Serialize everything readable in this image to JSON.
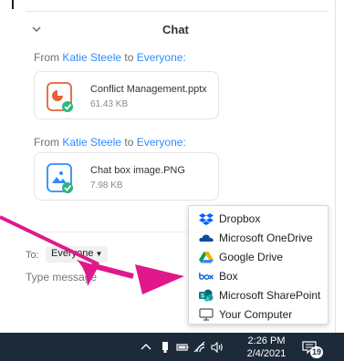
{
  "chat": {
    "title": "Chat",
    "messages": [
      {
        "from_prefix": "From ",
        "sender": "Katie Steele",
        "to_word": " to ",
        "recipient": "Everyone:",
        "file_name": "Conflict Management.pptx",
        "file_size": "61.43 KB",
        "file_type": "pptx"
      },
      {
        "from_prefix": "From ",
        "sender": "Katie Steele",
        "to_word": " to ",
        "recipient": "Everyone:",
        "file_name": "Chat box image.PNG",
        "file_size": "7.98 KB",
        "file_type": "png"
      }
    ],
    "to_label": "To:",
    "to_value": "Everyone",
    "message_placeholder": "Type message"
  },
  "share_menu": {
    "items": [
      {
        "label": "Dropbox",
        "icon": "dropbox-icon",
        "color": "#0061ff"
      },
      {
        "label": "Microsoft OneDrive",
        "icon": "onedrive-icon",
        "color": "#0a4f9c"
      },
      {
        "label": "Google Drive",
        "icon": "google-drive-icon",
        "color": "#f4b400"
      },
      {
        "label": "Box",
        "icon": "box-icon",
        "color": "#0061d5"
      },
      {
        "label": "Microsoft SharePoint",
        "icon": "sharepoint-icon",
        "color": "#038387"
      },
      {
        "label": "Your Computer",
        "icon": "computer-icon",
        "color": "#555555"
      }
    ]
  },
  "taskbar": {
    "time": "2:26 PM",
    "date": "2/4/2021",
    "notification_count": "19"
  },
  "colors": {
    "accent": "#2d8cff",
    "pptx_orange": "#e8613a",
    "png_blue": "#2d8cff",
    "check_green": "#2eb67d",
    "arrow_magenta": "#e0188c",
    "taskbar_bg": "#1c2a3a"
  }
}
